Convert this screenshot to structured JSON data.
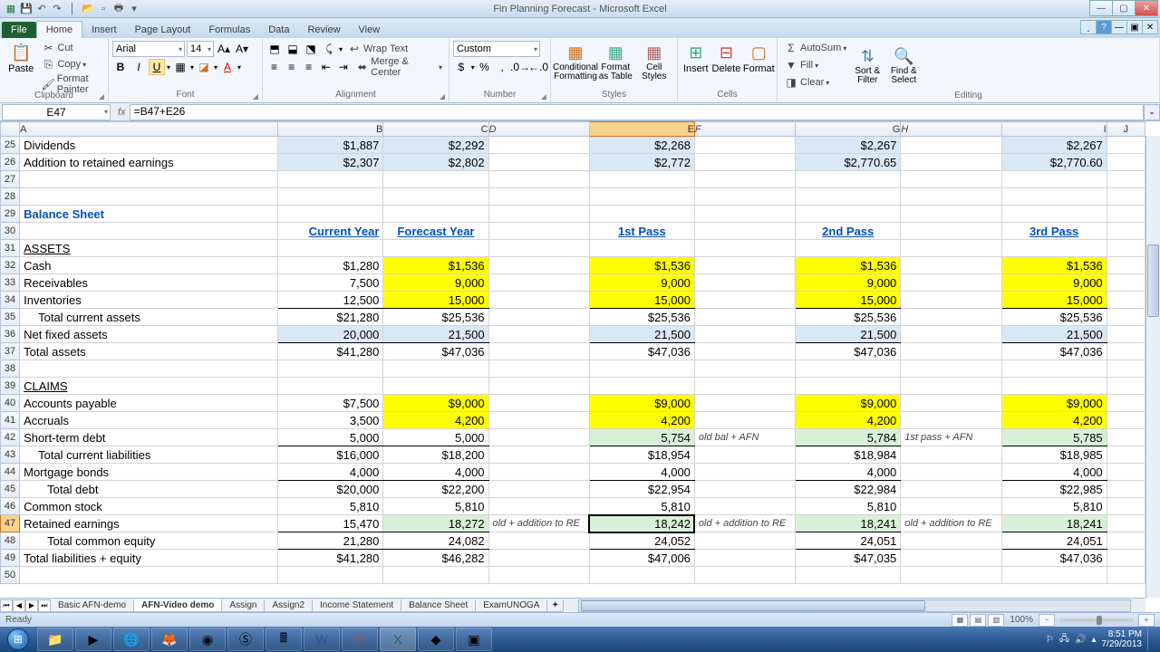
{
  "window": {
    "title": "Fin Planning Forecast - Microsoft Excel"
  },
  "tabs": {
    "file": "File",
    "home": "Home",
    "insert": "Insert",
    "pageLayout": "Page Layout",
    "formulas": "Formulas",
    "data": "Data",
    "review": "Review",
    "view": "View"
  },
  "ribbon": {
    "clipboard": {
      "label": "Clipboard",
      "paste": "Paste",
      "cut": "Cut",
      "copy": "Copy",
      "formatPainter": "Format Painter"
    },
    "font": {
      "label": "Font",
      "name": "Arial",
      "size": "14"
    },
    "alignment": {
      "label": "Alignment",
      "wrap": "Wrap Text",
      "merge": "Merge & Center"
    },
    "number": {
      "label": "Number",
      "format": "Custom"
    },
    "styles": {
      "label": "Styles",
      "cond": "Conditional Formatting",
      "asTable": "Format as Table",
      "cell": "Cell Styles"
    },
    "cells": {
      "label": "Cells",
      "insert": "Insert",
      "delete": "Delete",
      "format": "Format"
    },
    "editing": {
      "label": "Editing",
      "autosum": "AutoSum",
      "fill": "Fill",
      "clear": "Clear",
      "sort": "Sort & Filter",
      "find": "Find & Select"
    }
  },
  "nameBox": "E47",
  "formula": "=B47+E26",
  "cols": [
    "A",
    "B",
    "C",
    "D",
    "E",
    "F",
    "G",
    "H",
    "I",
    "J"
  ],
  "rows": [
    {
      "n": 25,
      "a": "Dividends",
      "b": "$1,887",
      "c": "$2,292",
      "e": "$2,268",
      "g": "$2,267",
      "i": "$2,267",
      "fmt": "lblue"
    },
    {
      "n": 26,
      "a": "Addition to retained earnings",
      "b": "$2,307",
      "c": "$2,802",
      "e": "$2,772",
      "g": "$2,770.65",
      "i": "$2,770.60",
      "fmt": "lblue"
    },
    {
      "n": 27
    },
    {
      "n": 28
    },
    {
      "n": 29,
      "a": "Balance Sheet",
      "aCls": "bold blue"
    },
    {
      "n": 30,
      "b": "Current Year",
      "c": "Forecast Year",
      "e": "1st Pass",
      "g": "2nd Pass",
      "i": "3rd Pass",
      "hdr": true
    },
    {
      "n": 31,
      "a": "ASSETS",
      "aCls": "uline"
    },
    {
      "n": 32,
      "a": "Cash",
      "b": "$1,280",
      "c": "$1,536",
      "e": "$1,536",
      "g": "$1,536",
      "i": "$1,536",
      "ylw": true
    },
    {
      "n": 33,
      "a": "Receivables",
      "b": "7,500",
      "c": "9,000",
      "e": "9,000",
      "g": "9,000",
      "i": "9,000",
      "ylw": true
    },
    {
      "n": 34,
      "a": "Inventories",
      "b": "12,500",
      "c": "15,000",
      "e": "15,000",
      "g": "15,000",
      "i": "15,000",
      "ylw": true,
      "bdr": true
    },
    {
      "n": 35,
      "a": "Total current assets",
      "aCls": "indent1",
      "b": "$21,280",
      "c": "$25,536",
      "e": "$25,536",
      "g": "$25,536",
      "i": "$25,536"
    },
    {
      "n": 36,
      "a": "Net fixed assets",
      "b": "20,000",
      "c": "21,500",
      "e": "21,500",
      "g": "21,500",
      "i": "21,500",
      "fmt": "lblue",
      "bdr": true
    },
    {
      "n": 37,
      "a": "Total assets",
      "b": "$41,280",
      "c": "$47,036",
      "e": "$47,036",
      "g": "$47,036",
      "i": "$47,036"
    },
    {
      "n": 38
    },
    {
      "n": 39,
      "a": "CLAIMS",
      "aCls": "uline"
    },
    {
      "n": 40,
      "a": "Accounts payable",
      "b": "$7,500",
      "c": "$9,000",
      "e": "$9,000",
      "g": "$9,000",
      "i": "$9,000",
      "ylw": true
    },
    {
      "n": 41,
      "a": "Accruals",
      "b": "3,500",
      "c": "4,200",
      "e": "4,200",
      "g": "4,200",
      "i": "4,200",
      "ylw": true
    },
    {
      "n": 42,
      "a": "Short-term debt",
      "b": "5,000",
      "c": "5,000",
      "e": "5,754",
      "f": "old bal + AFN",
      "g": "5,784",
      "h": "1st pass + AFN",
      "i": "5,785",
      "grnE": true,
      "bdr": true
    },
    {
      "n": 43,
      "a": "Total current liabilities",
      "aCls": "indent1",
      "b": "$16,000",
      "c": "$18,200",
      "e": "$18,954",
      "g": "$18,984",
      "i": "$18,985"
    },
    {
      "n": 44,
      "a": "Mortgage bonds",
      "b": "4,000",
      "c": "4,000",
      "e": "4,000",
      "g": "4,000",
      "i": "4,000",
      "bdr": true
    },
    {
      "n": 45,
      "a": "Total debt",
      "aCls": "indent2",
      "b": "$20,000",
      "c": "$22,200",
      "e": "$22,954",
      "g": "$22,984",
      "i": "$22,985"
    },
    {
      "n": 46,
      "a": "Common stock",
      "b": "5,810",
      "c": "5,810",
      "e": "5,810",
      "g": "5,810",
      "i": "5,810"
    },
    {
      "n": 47,
      "a": "Retained earnings",
      "b": "15,470",
      "c": "18,272",
      "d": "old + addition to RE",
      "e": "18,242",
      "f": "old + addition to RE",
      "g": "18,241",
      "h": "old + addition to RE",
      "i": "18,241",
      "grnC": true,
      "active": true,
      "bdr": true
    },
    {
      "n": 48,
      "a": "Total common equity",
      "aCls": "indent2",
      "b": "21,280",
      "c": "24,082",
      "e": "24,052",
      "g": "24,051",
      "i": "24,051",
      "bdr": true
    },
    {
      "n": 49,
      "a": "Total liabilities + equity",
      "b": "$41,280",
      "c": "$46,282",
      "e": "$47,006",
      "g": "$47,035",
      "i": "$47,036"
    },
    {
      "n": 50
    }
  ],
  "sheetTabs": [
    "Basic AFN-demo",
    "AFN-Video demo",
    "Assign",
    "Assign2",
    "Income Statement",
    "Balance Sheet",
    "ExamUNOGA"
  ],
  "activeSheet": 1,
  "status": {
    "ready": "Ready",
    "zoom": "100%"
  },
  "clock": {
    "time": "8:51 PM",
    "date": "7/29/2013"
  }
}
